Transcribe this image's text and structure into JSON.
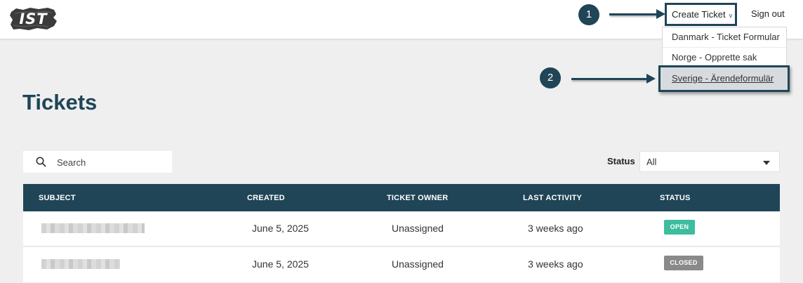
{
  "header": {
    "logo_text": "IST",
    "create_ticket_label": "Create Ticket",
    "create_ticket_caret": "v",
    "sign_out_label": "Sign out"
  },
  "dropdown": {
    "items": [
      {
        "label": "Danmark - Ticket Formular"
      },
      {
        "label": "Norge - Opprette sak"
      },
      {
        "label": "Sverige - Ärendeformulär"
      }
    ]
  },
  "annotations": {
    "step1": "1",
    "step2": "2"
  },
  "page": {
    "title": "Tickets"
  },
  "search": {
    "placeholder": "Search",
    "value": ""
  },
  "status_filter": {
    "label": "Status",
    "selected": "All"
  },
  "table": {
    "columns": [
      "SUBJECT",
      "CREATED",
      "TICKET OWNER",
      "LAST ACTIVITY",
      "STATUS"
    ],
    "rows": [
      {
        "subject": "",
        "created": "June 5, 2025",
        "owner": "Unassigned",
        "last_activity": "3 weeks ago",
        "status": "OPEN",
        "status_color": "#3dbd9e"
      },
      {
        "subject": "",
        "created": "June 5, 2025",
        "owner": "Unassigned",
        "last_activity": "3 weeks ago",
        "status": "CLOSED",
        "status_color": "#8a8a8a"
      }
    ]
  },
  "colors": {
    "brand": "#1f4557",
    "open": "#3dbd9e",
    "closed": "#8a8a8a",
    "background": "#efefef"
  }
}
